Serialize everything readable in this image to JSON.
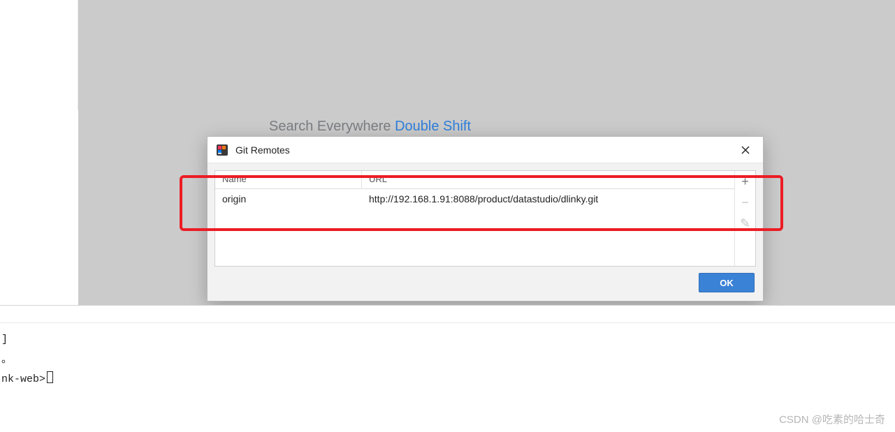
{
  "background": {
    "search_label": "Search Everywhere ",
    "search_shortcut": "Double Shift"
  },
  "dialog": {
    "title": "Git Remotes",
    "columns": {
      "name": "Name",
      "url": "URL"
    },
    "rows": [
      {
        "name": "origin",
        "url": "http://192.168.1.91:8088/product/datastudio/dlinky.git"
      }
    ],
    "buttons": {
      "ok": "OK"
    },
    "toolbar": {
      "add": "+",
      "remove": "−",
      "edit": "✎"
    }
  },
  "terminal": {
    "line1": "]",
    "line2": "。",
    "line3": "nk-web>"
  },
  "watermark": "CSDN @吃素的哈士奇"
}
